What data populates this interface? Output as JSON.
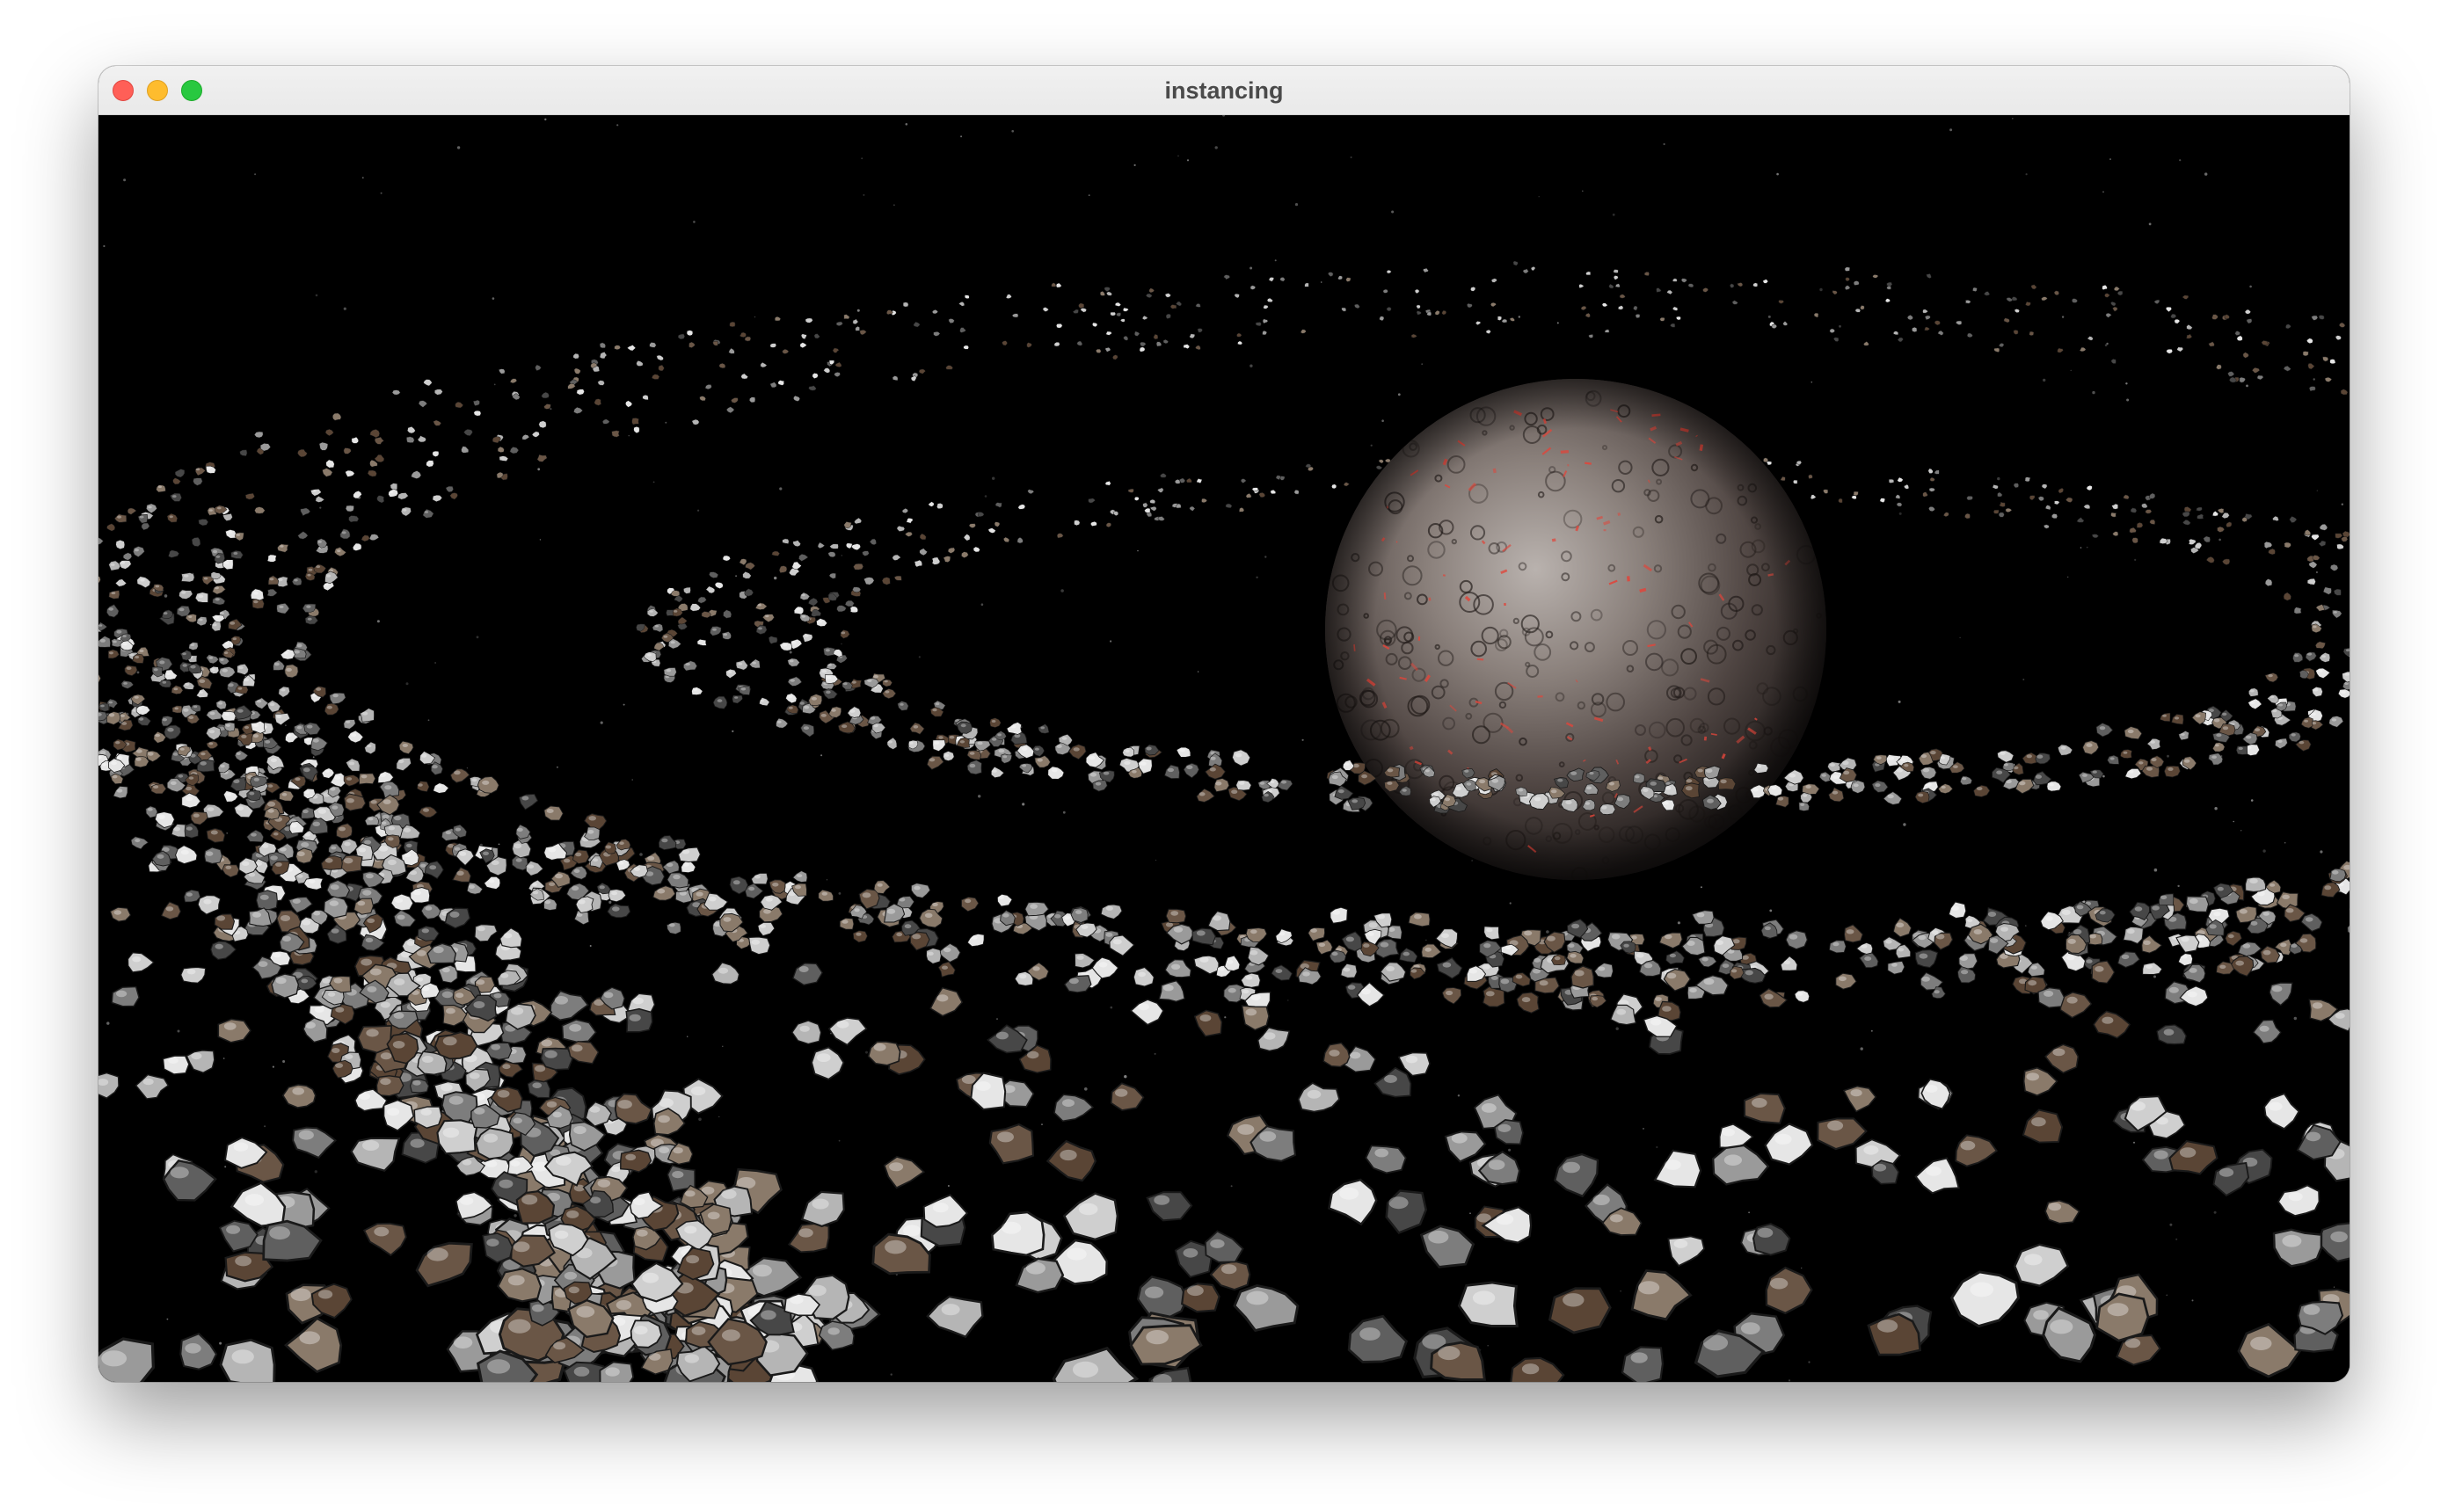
{
  "window": {
    "title": "instancing"
  },
  "titlebar": {
    "buttons": [
      {
        "name": "close",
        "color": "#ff5f57"
      },
      {
        "name": "minimize",
        "color": "#febc2e"
      },
      {
        "name": "zoom",
        "color": "#28c840"
      }
    ]
  },
  "scene": {
    "background_color": "#000000",
    "planet": {
      "name": "planet",
      "colors": [
        "#a79f9b",
        "#5e5450",
        "#2b2422"
      ],
      "accent": "#e0453a"
    },
    "asteroid_ring": {
      "name": "asteroid-ring",
      "colors": [
        "#d9d9d9",
        "#8e8e8e",
        "#5a4636",
        "#3c3c3c"
      ]
    }
  }
}
